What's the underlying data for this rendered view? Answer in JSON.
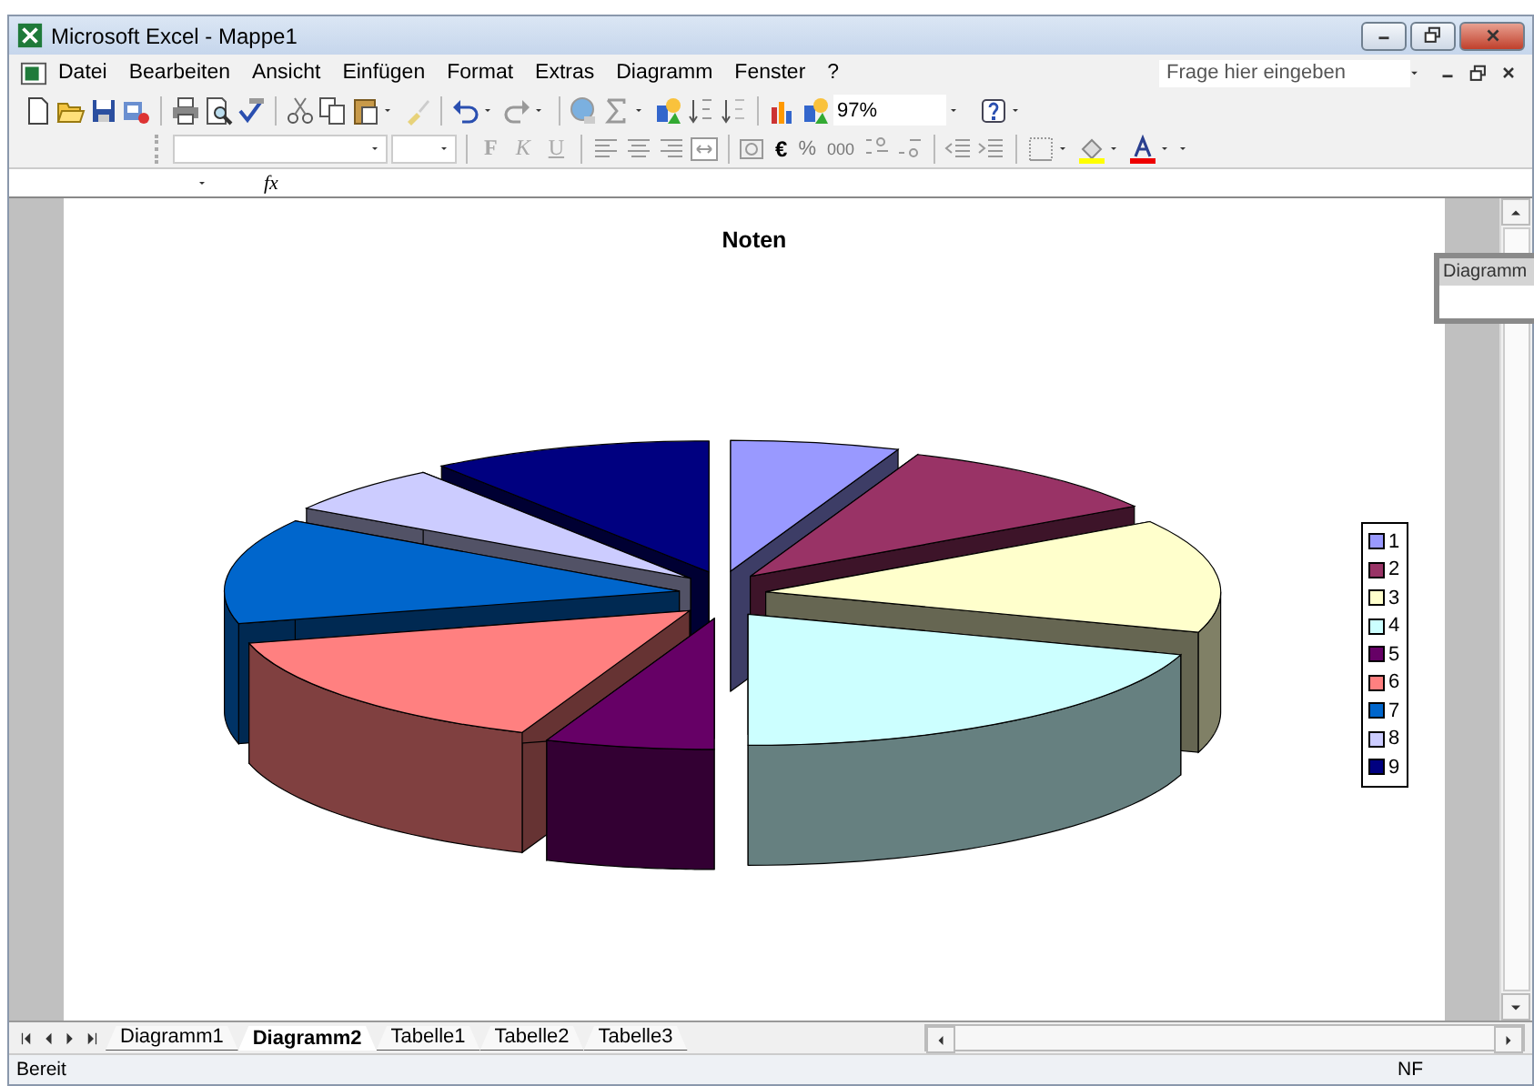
{
  "window": {
    "title": "Microsoft Excel - Mappe1"
  },
  "menu": [
    "Datei",
    "Bearbeiten",
    "Ansicht",
    "Einfügen",
    "Format",
    "Extras",
    "Diagramm",
    "Fenster",
    "?"
  ],
  "help_field": {
    "placeholder": "Frage hier eingeben"
  },
  "standard_toolbar": {
    "zoom": "97%"
  },
  "format_toolbar": {
    "disabled": true,
    "buttons": [
      "F",
      "K",
      "U"
    ],
    "currency": "€",
    "percent": "%",
    "thousands": "000"
  },
  "formula_bar": {
    "label": "fx"
  },
  "chart": {
    "title": "Noten",
    "legend": [
      {
        "label": "1",
        "color": "#9999ff"
      },
      {
        "label": "2",
        "color": "#993366"
      },
      {
        "label": "3",
        "color": "#ffffcc"
      },
      {
        "label": "4",
        "color": "#ccffff"
      },
      {
        "label": "5",
        "color": "#660066"
      },
      {
        "label": "6",
        "color": "#ff8080"
      },
      {
        "label": "7",
        "color": "#0066cc"
      },
      {
        "label": "8",
        "color": "#ccccff"
      },
      {
        "label": "9",
        "color": "#000080"
      }
    ]
  },
  "floating_toolbar": {
    "title": "Diagramm"
  },
  "sheet_tabs": [
    {
      "label": "Diagramm1",
      "selected": false
    },
    {
      "label": "Diagramm2",
      "selected": true
    },
    {
      "label": "Tabelle1",
      "selected": false
    },
    {
      "label": "Tabelle2",
      "selected": false
    },
    {
      "label": "Tabelle3",
      "selected": false
    }
  ],
  "status_bar": {
    "left": "Bereit",
    "right": "NF"
  }
}
